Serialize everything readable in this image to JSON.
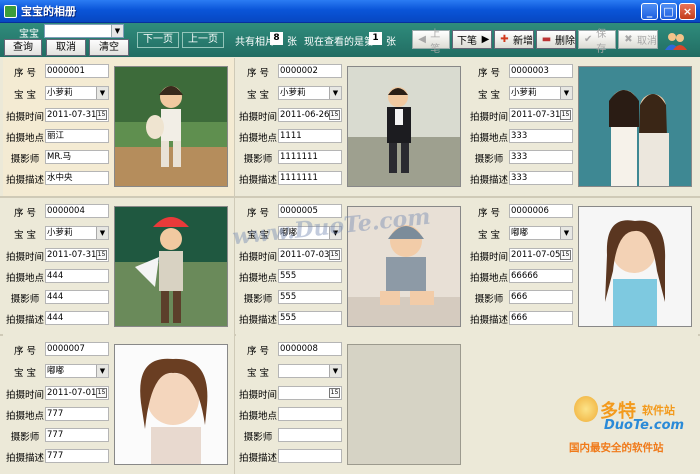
{
  "window": {
    "title": "宝宝的相册"
  },
  "toolbar": {
    "baby_label": "宝宝",
    "baby_value": "",
    "query_label": "查询",
    "cancel_label": "取消",
    "clear_label": "清空",
    "next_page_label": "下一页",
    "prev_page_label": "上一页",
    "total_prefix": "共有相片",
    "total_count": "8",
    "total_suffix": "张",
    "viewing_prefix": "现在查看的是第",
    "viewing_index": "1",
    "viewing_suffix": "张",
    "prev_label": "上笔",
    "next_label": "下笔",
    "add_label": "新增",
    "delete_label": "删除",
    "save_label": "保存",
    "cancel2_label": "取消"
  },
  "field_labels": {
    "serial": "序 号",
    "baby": "宝 宝",
    "date": "拍摄时间",
    "place": "拍摄地点",
    "photographer": "摄影师",
    "desc": "拍摄描述"
  },
  "records": [
    {
      "serial": "0000001",
      "baby": "小萝莉",
      "date": "2011-07-31",
      "place": "丽江",
      "photographer": "MR.马",
      "desc": "水中央"
    },
    {
      "serial": "0000002",
      "baby": "小萝莉",
      "date": "2011-06-26",
      "place": "1111",
      "photographer": "1111111",
      "desc": "1111111"
    },
    {
      "serial": "0000003",
      "baby": "小萝莉",
      "date": "2011-07-31",
      "place": "333",
      "photographer": "333",
      "desc": "333"
    },
    {
      "serial": "0000004",
      "baby": "小萝莉",
      "date": "2011-07-31",
      "place": "444",
      "photographer": "444",
      "desc": "444"
    },
    {
      "serial": "0000005",
      "baby": "嘟嘟",
      "date": "2011-07-03",
      "place": "555",
      "photographer": "555",
      "desc": "555"
    },
    {
      "serial": "0000006",
      "baby": "嘟嘟",
      "date": "2011-07-05",
      "place": "66666",
      "photographer": "666",
      "desc": "666"
    },
    {
      "serial": "0000007",
      "baby": "嘟嘟",
      "date": "2011-07-01",
      "place": "777",
      "photographer": "777",
      "desc": "777"
    },
    {
      "serial": "0000008",
      "baby": "",
      "date": "",
      "place": "",
      "photographer": "",
      "desc": ""
    }
  ],
  "watermark": {
    "center_text": "www.DuoTe.com",
    "logo_big": "多特",
    "logo_small": "软件站",
    "logo_domain": "DuoTe.com",
    "logo_slogan": "国内最安全的软件站"
  }
}
